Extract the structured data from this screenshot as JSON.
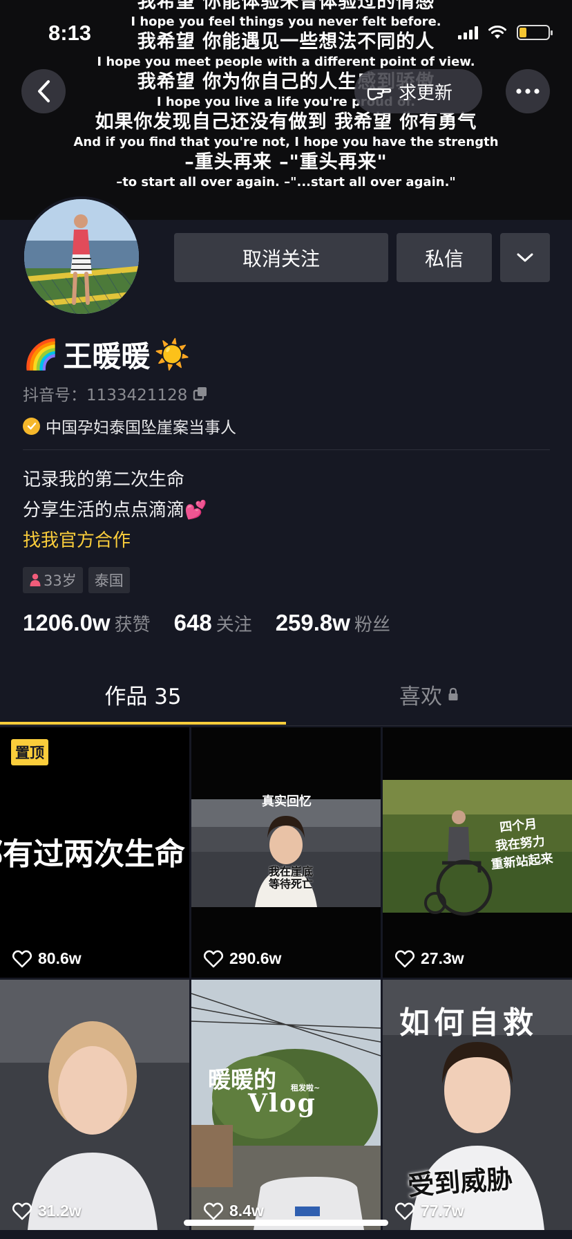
{
  "status_bar": {
    "time": "8:13"
  },
  "banner": {
    "lyrics": [
      {
        "cn": "我希望 你能体验未曾体验过的情感",
        "en": "I hope you feel things you never felt before."
      },
      {
        "cn": "我希望 你能遇见一些想法不同的人",
        "en": "I hope you meet people with a different point of view."
      },
      {
        "cn": "我希望 你为你自己的人生感到骄傲",
        "en": "I hope you live a life you're proud of."
      },
      {
        "cn": "如果你发现自己还没有做到 我希望 你有勇气",
        "en": "And if you find that you're not, I hope you have the strength"
      },
      {
        "cn": "–重头再来 –\"重头再来\"",
        "en": "–to start all over again. –\"...start all over again.\""
      }
    ],
    "update_label": "求更新"
  },
  "profile": {
    "unfollow_label": "取消关注",
    "message_label": "私信",
    "name": "王暖暖",
    "name_prefix_emoji": "🌈",
    "name_suffix_emoji": "☀️",
    "douyin_id": "抖音号：1133421128",
    "verification": "中国孕妇泰国坠崖案当事人",
    "bio_lines": [
      "记录我的第二次生命",
      "分享生活的点点滴滴💕"
    ],
    "bio_link": "找我官方合作",
    "tags": {
      "age": "33岁",
      "location": "泰国"
    },
    "stats": {
      "likes_num": "1206.0w",
      "likes_label": "获赞",
      "following_num": "648",
      "following_label": "关注",
      "followers_num": "259.8w",
      "followers_label": "粉丝"
    }
  },
  "tabs": {
    "works": "作品 35",
    "likes": "喜欢"
  },
  "videos": [
    {
      "likes": "80.6w",
      "pinned_label": "置顶",
      "overlay": "都有过两次生命!"
    },
    {
      "likes": "290.6w",
      "overlay_top": "真实回忆",
      "overlay_bottom_1": "我在崖底",
      "overlay_bottom_2": "等待死亡"
    },
    {
      "likes": "27.3w",
      "overlay_1": "四个月",
      "overlay_2": "我在努力",
      "overlay_3": "重新站起来"
    },
    {
      "likes": "31.2w"
    },
    {
      "likes": "8.4w",
      "overlay_1": "暖暖的",
      "overlay_2": "Vlog",
      "overlay_small": "租发啦~"
    },
    {
      "likes": "77.7w",
      "overlay_top": "如何自救",
      "overlay_bottom": "受到威胁"
    }
  ],
  "colors": {
    "background": "#161823",
    "accent": "#facd3b",
    "button": "#393b44"
  }
}
